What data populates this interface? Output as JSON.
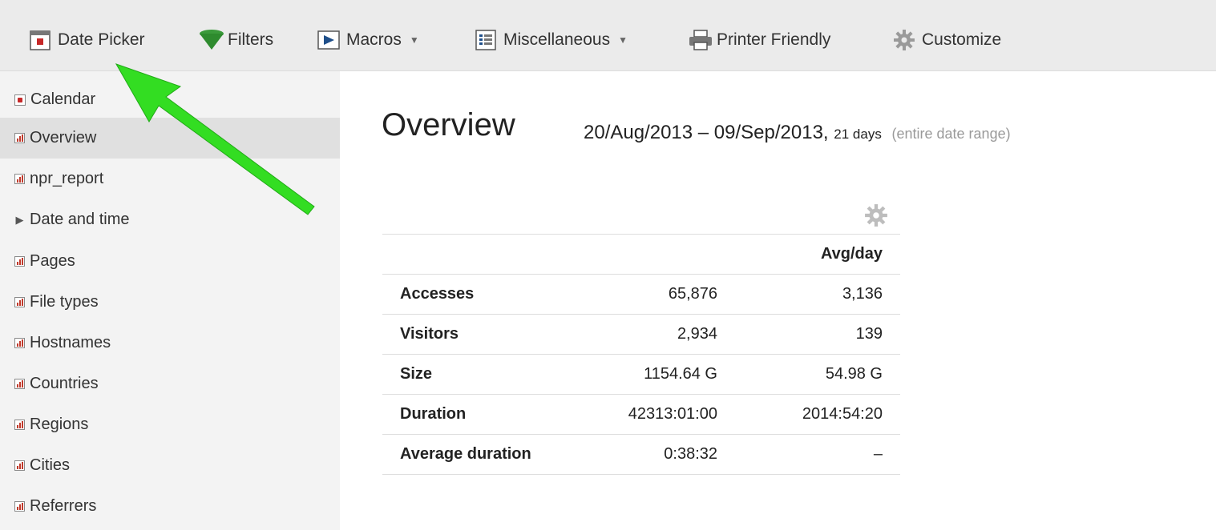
{
  "toolbar": {
    "items": [
      {
        "label": "Date Picker",
        "icon": "calendar-icon"
      },
      {
        "label": "Filters",
        "icon": "funnel-icon"
      },
      {
        "label": "Macros",
        "icon": "play-icon"
      },
      {
        "label": "Miscellaneous",
        "icon": "list-icon"
      },
      {
        "label": "Printer Friendly",
        "icon": "printer-icon"
      },
      {
        "label": "Customize",
        "icon": "gear-icon"
      }
    ]
  },
  "sidebar": {
    "items": [
      {
        "label": "Calendar",
        "icon": "calendar-icon"
      },
      {
        "label": "Overview",
        "icon": "report-icon",
        "active": true
      },
      {
        "label": "npr_report",
        "icon": "report-icon"
      },
      {
        "label": "Date and time",
        "icon": "triangle-right-icon"
      },
      {
        "label": "Pages",
        "icon": "report-icon"
      },
      {
        "label": "File types",
        "icon": "report-icon"
      },
      {
        "label": "Hostnames",
        "icon": "report-icon"
      },
      {
        "label": "Countries",
        "icon": "report-icon"
      },
      {
        "label": "Regions",
        "icon": "report-icon"
      },
      {
        "label": "Cities",
        "icon": "report-icon"
      },
      {
        "label": "Referrers",
        "icon": "report-icon"
      }
    ]
  },
  "main": {
    "title": "Overview",
    "date_range": "20/Aug/2013 – 09/Sep/2013,",
    "days": "21 days",
    "range_note": "(entire date range)",
    "table": {
      "header": [
        "",
        "",
        "Avg/day"
      ],
      "rows": [
        {
          "label": "Accesses",
          "total": "65,876",
          "avg": "3,136"
        },
        {
          "label": "Visitors",
          "total": "2,934",
          "avg": "139"
        },
        {
          "label": "Size",
          "total": "1154.64 G",
          "avg": "54.98 G"
        },
        {
          "label": "Duration",
          "total": "42313:01:00",
          "avg": "2014:54:20"
        },
        {
          "label": "Average duration",
          "total": "0:38:32",
          "avg": "–"
        }
      ]
    }
  },
  "colors": {
    "toolbar_bg": "#ebebeb",
    "sidebar_bg": "#f3f3f3",
    "active_item_bg": "#e0e0e0",
    "arrow": "#33dd22",
    "muted_text": "#999999"
  }
}
